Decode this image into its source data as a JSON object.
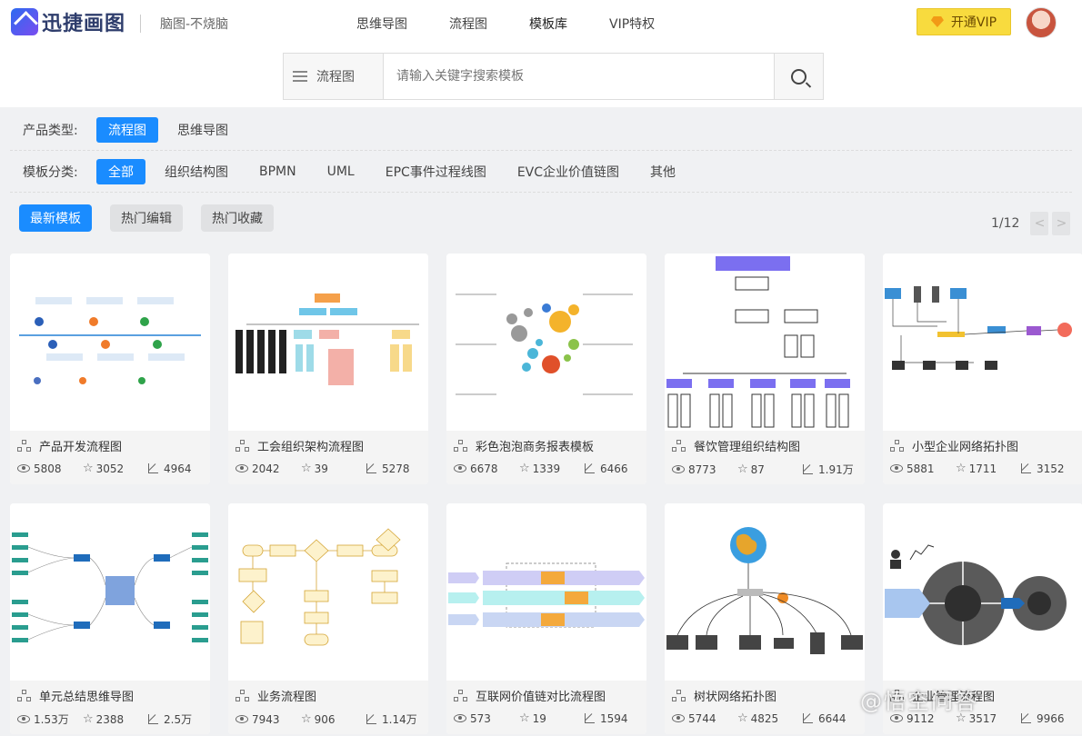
{
  "header": {
    "brand": "迅捷画图",
    "slogan": "脑图-不烧脑",
    "nav": [
      "思维导图",
      "流程图",
      "模板库",
      "VIP特权"
    ],
    "nav_active": "模板库",
    "vip_button": "开通VIP"
  },
  "search": {
    "type_label": "流程图",
    "placeholder": "请输入关键字搜索模板"
  },
  "filters": {
    "product_label": "产品类型:",
    "product_options": [
      "流程图",
      "思维导图"
    ],
    "category_label": "模板分类:",
    "category_options": [
      "全部",
      "组织结构图",
      "BPMN",
      "UML",
      "EPC事件过程线图",
      "EVC企业价值链图",
      "其他"
    ]
  },
  "sort_tabs": [
    "最新模板",
    "热门编辑",
    "热门收藏"
  ],
  "pagination": {
    "text": "1/12",
    "prev": "<",
    "next": ">"
  },
  "templates": [
    {
      "title": "产品开发流程图",
      "views": "5808",
      "stars": "3052",
      "edits": "4964"
    },
    {
      "title": "工会组织架构流程图",
      "views": "2042",
      "stars": "39",
      "edits": "5278"
    },
    {
      "title": "彩色泡泡商务报表模板",
      "views": "6678",
      "stars": "1339",
      "edits": "6466"
    },
    {
      "title": "餐饮管理组织结构图",
      "views": "8773",
      "stars": "87",
      "edits": "1.91万"
    },
    {
      "title": "小型企业网络拓扑图",
      "views": "5881",
      "stars": "1711",
      "edits": "3152"
    },
    {
      "title": "单元总结思维导图",
      "views": "1.53万",
      "stars": "2388",
      "edits": "2.5万"
    },
    {
      "title": "业务流程图",
      "views": "7943",
      "stars": "906",
      "edits": "1.14万"
    },
    {
      "title": "互联网价值链对比流程图",
      "views": "573",
      "stars": "19",
      "edits": "1594"
    },
    {
      "title": "树状网络拓扑图",
      "views": "5744",
      "stars": "4825",
      "edits": "6644"
    },
    {
      "title": "企业管理流程图",
      "views": "9112",
      "stars": "3517",
      "edits": "9966"
    }
  ],
  "watermark": "@悟空问答",
  "colors": {
    "primary": "#1a8cff",
    "vip": "#f8db3e"
  }
}
